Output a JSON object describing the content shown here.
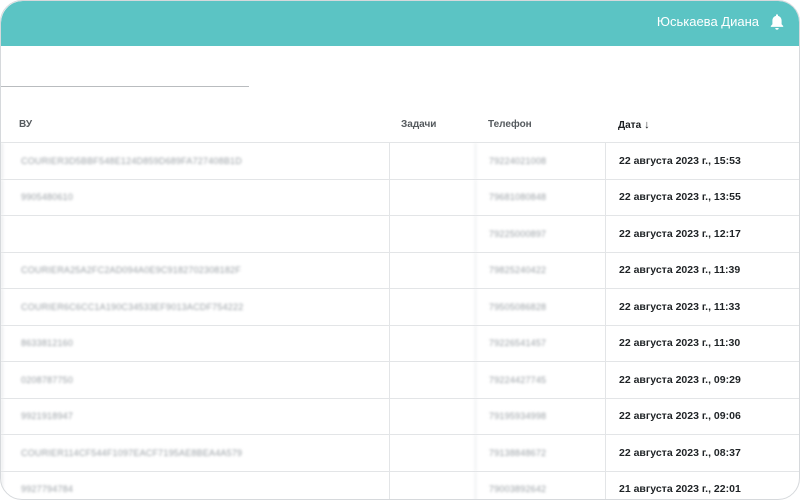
{
  "header": {
    "user_name": "Юськаева Диана",
    "bell_icon": "bell-icon",
    "accent_color": "#5bc4c4"
  },
  "table": {
    "columns": [
      "ВУ",
      "Задачи",
      "Телефон",
      "Дата"
    ],
    "sort_indicator": "↓",
    "rows": [
      {
        "vu": "COURIER3D5BBF548E124D859D689FA727408B1D",
        "tasks": "",
        "phone": "79224021008",
        "date": "22 августа 2023 г., 15:53"
      },
      {
        "vu": "9905480610",
        "tasks": "",
        "phone": "79681080848",
        "date": "22 августа 2023 г., 13:55"
      },
      {
        "vu": "",
        "tasks": "",
        "phone": "79225000897",
        "date": "22 августа 2023 г., 12:17"
      },
      {
        "vu": "COURIERA25A2FC2AD094A0E9C9182702308182F",
        "tasks": "",
        "phone": "79825240422",
        "date": "22 августа 2023 г., 11:39"
      },
      {
        "vu": "COURIER6C6CC1A190C34533EF9013ACDF754222",
        "tasks": "",
        "phone": "79505086828",
        "date": "22 августа 2023 г., 11:33"
      },
      {
        "vu": "8633812160",
        "tasks": "",
        "phone": "79226541457",
        "date": "22 августа 2023 г., 11:30"
      },
      {
        "vu": "0208787750",
        "tasks": "",
        "phone": "79224427745",
        "date": "22 августа 2023 г., 09:29"
      },
      {
        "vu": "9921918947",
        "tasks": "",
        "phone": "79195934998",
        "date": "22 августа 2023 г., 09:06"
      },
      {
        "vu": "COURIER114CF544F1097EACF7195AE8BEA4A579",
        "tasks": "",
        "phone": "79138848672",
        "date": "22 августа 2023 г., 08:37"
      },
      {
        "vu": "9927794784",
        "tasks": "",
        "phone": "79003892642",
        "date": "21 августа 2023 г., 22:01"
      }
    ]
  }
}
